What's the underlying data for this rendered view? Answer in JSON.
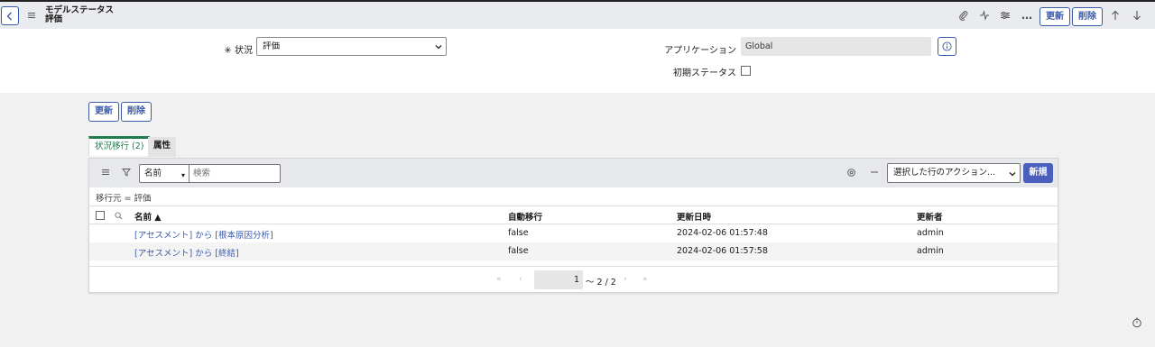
{
  "header": {
    "title_line1": "モデルステータス",
    "title_line2": "評価",
    "update_label": "更新",
    "delete_label": "削除",
    "more_icon": "…"
  },
  "form": {
    "status_label": "状況",
    "status_required_mark": "✳",
    "status_value": "評価",
    "application_label": "アプリケーション",
    "application_value": "Global",
    "initial_status_label": "初期ステータス"
  },
  "actions": {
    "update_label": "更新",
    "delete_label": "削除"
  },
  "tabs": [
    {
      "label": "状況移行 (2)",
      "active": true
    },
    {
      "label": "属性",
      "active": false
    }
  ],
  "list": {
    "search_field": "名前",
    "search_placeholder": "検索",
    "action_select": "選択した行のアクション...",
    "new_label": "新規",
    "breadcrumb": "移行元 = 評価",
    "columns": [
      "名前 ▲",
      "自動移行",
      "更新日時",
      "更新者"
    ],
    "rows": [
      {
        "name": "[アセスメント] から [根本原因分析]",
        "auto": "false",
        "updated": "2024-02-06 01:57:48",
        "by": "admin"
      },
      {
        "name": "[アセスメント] から [終結]",
        "auto": "false",
        "updated": "2024-02-06 01:57:58",
        "by": "admin"
      }
    ],
    "page_current": "1",
    "page_total": "〜 2 / 2"
  },
  "colors": {
    "accent": "#3b5bab",
    "tab_active": "#1f7a4d",
    "new_button": "#4b5fbd"
  }
}
